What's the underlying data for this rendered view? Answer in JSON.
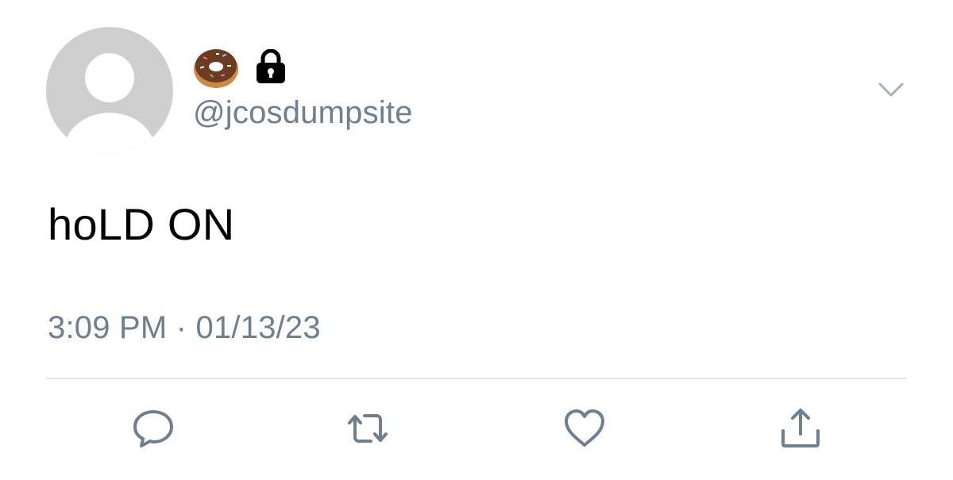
{
  "tweet": {
    "display_name_icons": [
      "donut-emoji",
      "lock-icon"
    ],
    "handle": "@jcosdumpsite",
    "text": "hoLD ON",
    "timestamp": "3:09 PM · 01/13/23"
  },
  "actions": [
    "reply-icon",
    "retweet-icon",
    "like-icon",
    "share-icon"
  ],
  "colors": {
    "secondary_text": "#6e7f8d",
    "avatar_bg": "#cfcfcf",
    "divider": "#e3e6e8",
    "icon": "#6e7f8d"
  }
}
